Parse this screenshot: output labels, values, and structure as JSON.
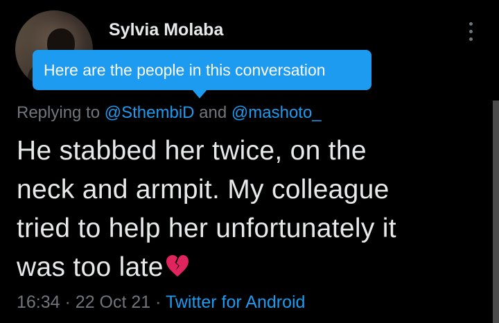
{
  "tweet": {
    "display_name": "Sylvia Molaba",
    "tooltip": "Here are the people in this conversation",
    "replying_prefix": "Replying to",
    "replying_mention_1": "@SthembiD",
    "replying_and": "and",
    "replying_mention_2": "@mashoto_",
    "text_lines": [
      "He stabbed her twice, on the",
      "neck and armpit. My colleague",
      "tried to help her unfortunately it",
      "was too late"
    ],
    "emoji": "broken-heart-icon",
    "time": "16:34",
    "separator": "·",
    "date": "22 Oct 21",
    "source": "Twitter for Android"
  },
  "colors": {
    "background": "#000000",
    "text": "#e7e9ea",
    "secondary_text": "#71767b",
    "accent": "#1d9bf0",
    "emoji": "#e0245e"
  }
}
